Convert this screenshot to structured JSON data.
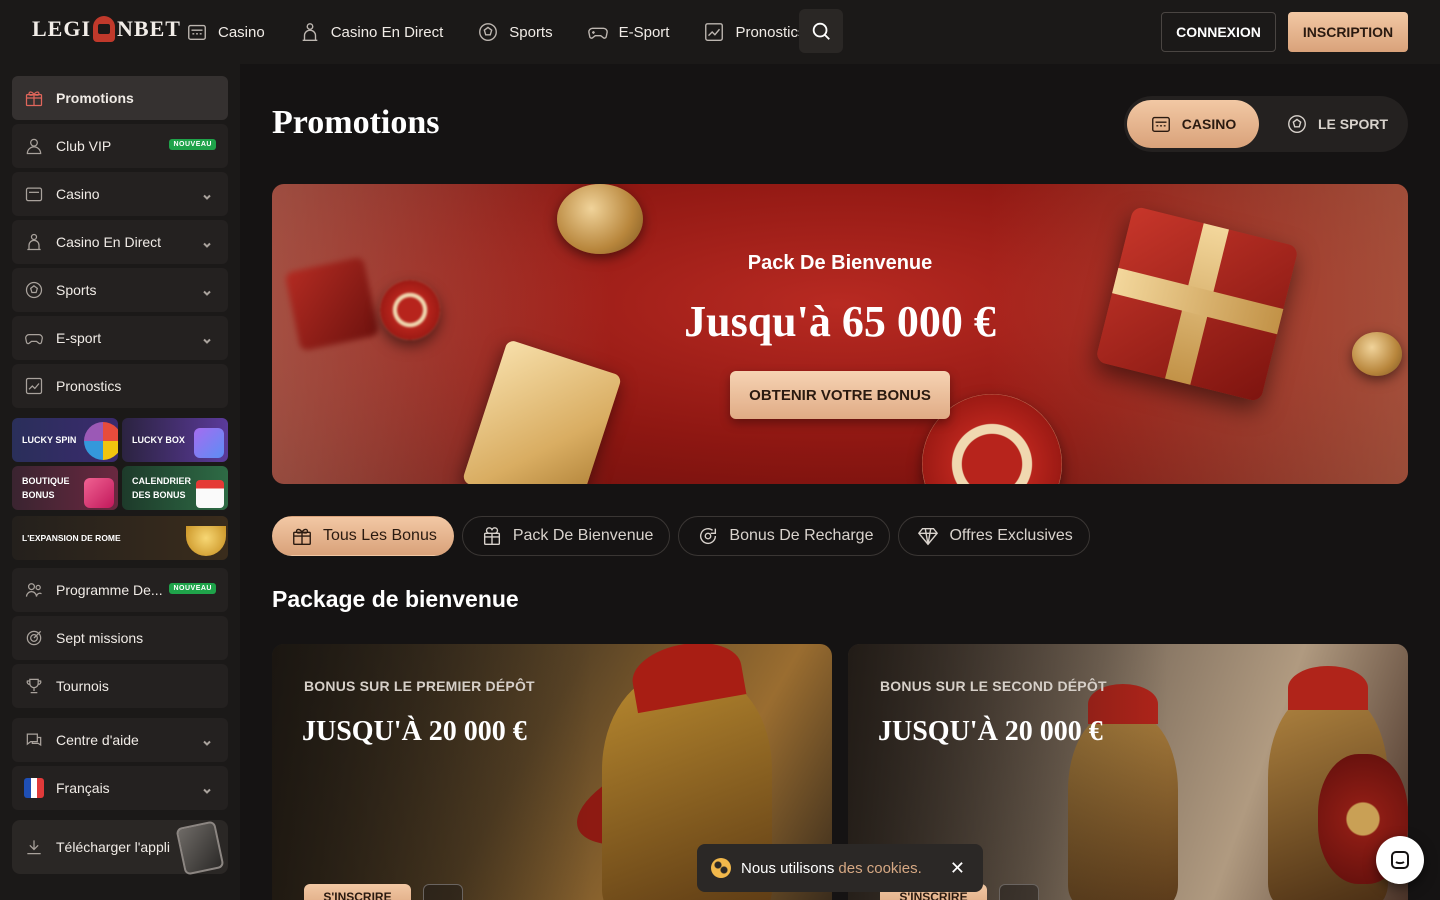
{
  "brand": {
    "logo_left": "LEGI",
    "logo_right": "NBET"
  },
  "nav": [
    {
      "label": "Casino",
      "icon": "slot-machine-icon"
    },
    {
      "label": "Casino En Direct",
      "icon": "dealer-icon"
    },
    {
      "label": "Sports",
      "icon": "soccer-ball-icon"
    },
    {
      "label": "E-Sport",
      "icon": "gamepad-icon"
    },
    {
      "label": "Pronostics",
      "icon": "chart-icon"
    }
  ],
  "header": {
    "login": "CONNEXION",
    "register": "INSCRIPTION"
  },
  "sidebar": {
    "items": [
      {
        "label": "Promotions",
        "icon": "gift-icon",
        "active": true
      },
      {
        "label": "Club VIP",
        "icon": "user-icon",
        "badge": "NOUVEAU"
      },
      {
        "label": "Casino",
        "icon": "slot-machine-icon"
      },
      {
        "label": "Casino En Direct",
        "icon": "dealer-icon"
      },
      {
        "label": "Sports",
        "icon": "soccer-ball-icon"
      },
      {
        "label": "E-sport",
        "icon": "gamepad-icon"
      },
      {
        "label": "Pronostics",
        "icon": "chart-icon"
      }
    ],
    "tiles": [
      {
        "label": "LUCKY SPIN"
      },
      {
        "label": "LUCKY BOX"
      },
      {
        "label": "BOUTIQUE BONUS"
      },
      {
        "label": "CALENDRIER DES BONUS"
      },
      {
        "label": "L'EXPANSION DE ROME"
      }
    ],
    "items2": [
      {
        "label": "Programme De...",
        "icon": "users-icon",
        "badge": "NOUVEAU"
      },
      {
        "label": "Sept missions",
        "icon": "target-icon"
      },
      {
        "label": "Tournois",
        "icon": "trophy-icon"
      }
    ],
    "help": "Centre d'aide",
    "language": "Français",
    "app": "Télécharger l'appli"
  },
  "main": {
    "title": "Promotions",
    "toggle": {
      "casino": "CASINO",
      "sport": "LE SPORT"
    },
    "banner": {
      "subtitle": "Pack De Bienvenue",
      "title": "Jusqu'à 65 000 €",
      "cta": "OBTENIR VOTRE BONUS"
    },
    "filters": [
      {
        "label": "Tous Les Bonus",
        "icon": "gift-icon",
        "active": true
      },
      {
        "label": "Pack De Bienvenue",
        "icon": "gift-box-icon"
      },
      {
        "label": "Bonus De Recharge",
        "icon": "reload-icon"
      },
      {
        "label": "Offres Exclusives",
        "icon": "diamond-icon"
      }
    ],
    "section_title": "Package de bienvenue",
    "cards": [
      {
        "kicker": "BONUS SUR LE PREMIER DÉPÔT",
        "amount": "JUSQU'À 20 000 €",
        "cta": "S'INSCRIRE"
      },
      {
        "kicker": "BONUS SUR LE SECOND DÉPÔT",
        "amount": "JUSQU'À 20 000 €",
        "cta": "S'INSCRIRE"
      }
    ]
  },
  "cookie": {
    "text": "Nous utilisons",
    "link": "des cookies.",
    "close": "✕"
  }
}
